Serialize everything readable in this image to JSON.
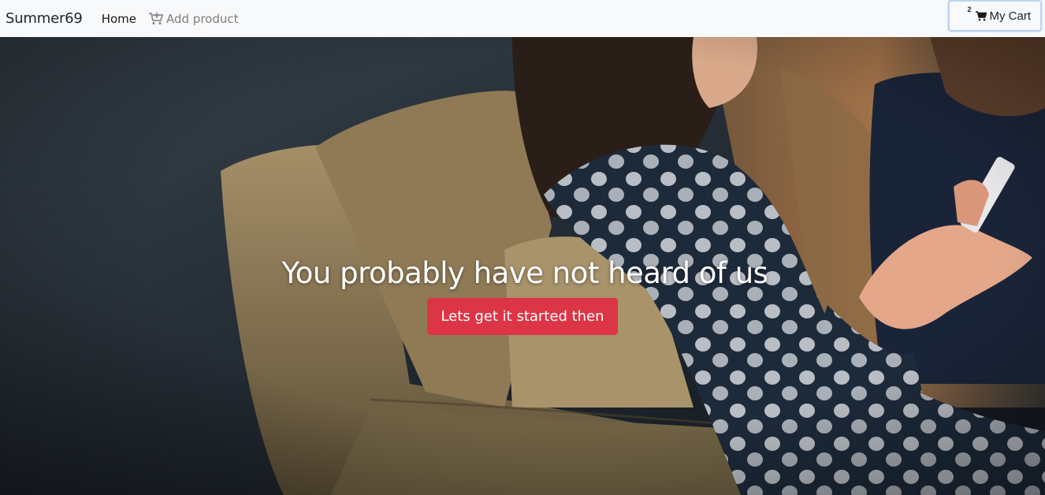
{
  "navbar": {
    "brand": "Summer69",
    "links": [
      {
        "label": "Home"
      },
      {
        "label": "Add product",
        "icon": "cart-plus-icon"
      }
    ],
    "cart": {
      "badge": "2",
      "label": "My Cart",
      "icon": "shopping-cart-icon"
    }
  },
  "hero": {
    "headline": "You probably have not heard of us",
    "cta_label": "Lets get it started then"
  },
  "colors": {
    "navbar_bg": "#f8f9fa",
    "cta_bg": "#dc3545",
    "headline": "#ffffff",
    "cart_focus_border": "#bcd4f2"
  }
}
